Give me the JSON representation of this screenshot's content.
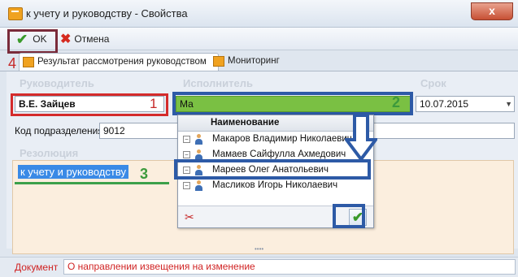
{
  "window": {
    "title": "к учету и руководству - Свойства",
    "close_label": "x"
  },
  "toolbar": {
    "ok_label": "OK",
    "cancel_label": "Отмена"
  },
  "tabs": [
    {
      "label": "Результат рассмотрения руководством",
      "active": true
    },
    {
      "label": "Мониторинг",
      "active": false
    }
  ],
  "form": {
    "manager_label": "Руководитель",
    "manager_value": "В.Е. Зайцев",
    "executor_label": "Исполнитель",
    "executor_value": "Ма",
    "deadline_label": "Срок",
    "deadline_value": "10.07.2015",
    "dept_code_label": "Код подразделения",
    "dept_code_value": "9012",
    "resolution_label": "Резолюция",
    "resolution_value": "к учету и руководству"
  },
  "annotations": {
    "n1": "1",
    "n2": "2",
    "n3": "3",
    "n4": "4"
  },
  "dropdown": {
    "column_header": "Наименование",
    "items": [
      {
        "name": "Макаров Владимир Николаевич"
      },
      {
        "name": "Мамаев Сайфулла Ахмедович"
      },
      {
        "name": "Мареев Олег Анатольевич"
      },
      {
        "name": "Масликов Игорь Николаевич"
      }
    ]
  },
  "document": {
    "label": "Документ",
    "value": "О направлении извещения на изменение"
  },
  "colors": {
    "annotation_red": "#d42b2b",
    "annotation_blue": "#2d5aa6",
    "annotation_green": "#3c9a3c",
    "executor_bg": "#7ac043"
  }
}
